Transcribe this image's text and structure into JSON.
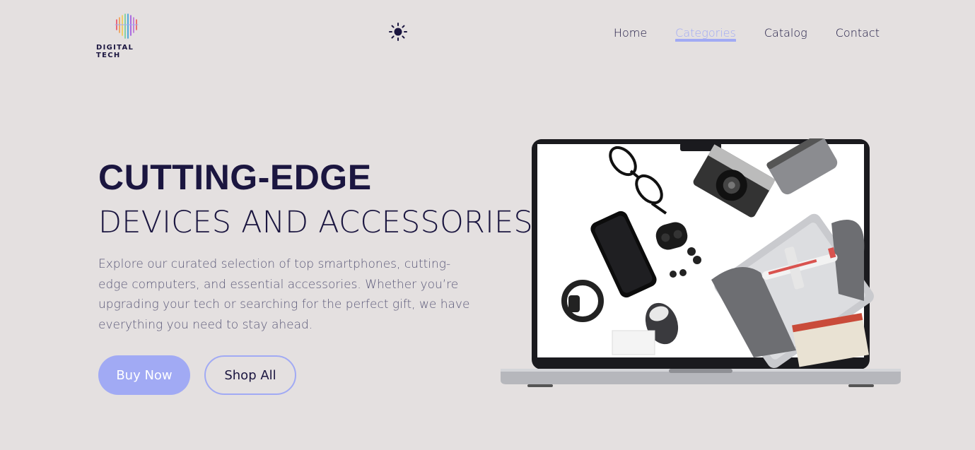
{
  "brand": {
    "name": "DIGITAL TECH",
    "logo_icon": "rainbow-lines-logo"
  },
  "theme_toggle": {
    "icon": "sun-icon"
  },
  "nav": {
    "items": [
      {
        "label": "Home",
        "active": false
      },
      {
        "label": "Categories",
        "active": true
      },
      {
        "label": "Catalog",
        "active": false
      },
      {
        "label": "Contact",
        "active": false
      }
    ]
  },
  "hero": {
    "title": "CUTTING-EDGE",
    "subtitle": "DEVICES AND ACCESSORIES",
    "description": "Explore our curated selection of top smartphones, cutting-edge computers, and essential accessories. Whether you’re upgrading your tech or searching for the perfect gift, we have everything you need to stay ahead.",
    "buy_label": "Buy Now",
    "shop_label": "Shop All",
    "image": "laptop-with-accessories-image"
  },
  "colors": {
    "background": "#e4e0e0",
    "primary_text": "#1b1640",
    "accent": "#a1aaf4",
    "muted_text": "#5a5878"
  }
}
